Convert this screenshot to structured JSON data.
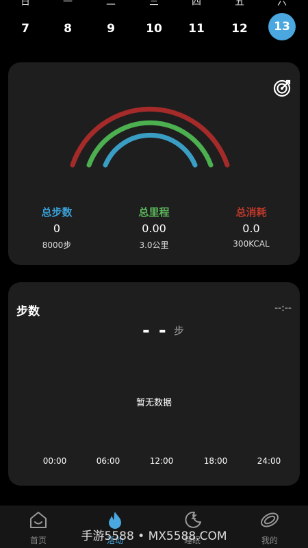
{
  "week": {
    "weekdays": [
      "日",
      "一",
      "二",
      "三",
      "四",
      "五",
      "六"
    ],
    "dates": [
      "7",
      "8",
      "9",
      "10",
      "11",
      "12",
      "13"
    ],
    "selected_index": 6
  },
  "summary": {
    "steps": {
      "label": "总步数",
      "value": "0",
      "goal": "8000步",
      "color": "#3aa0d8"
    },
    "distance": {
      "label": "总里程",
      "value": "0.00",
      "goal": "3.0公里",
      "color": "#5cb85c"
    },
    "calories": {
      "label": "总消耗",
      "value": "0.0",
      "goal": "300KCAL",
      "color": "#c0392b"
    }
  },
  "steps_card": {
    "title": "步数",
    "time": "--:--",
    "value": "- -",
    "unit": "步",
    "empty_text": "暂无数据",
    "ticks": [
      "00:00",
      "06:00",
      "12:00",
      "18:00",
      "24:00"
    ]
  },
  "nav": {
    "items": [
      {
        "label": "首页",
        "icon": "home-icon"
      },
      {
        "label": "活动",
        "icon": "flame-icon"
      },
      {
        "label": "睡眠",
        "icon": "moon-icon"
      },
      {
        "label": "我的",
        "icon": "ring-icon"
      }
    ],
    "active_index": 1,
    "accent": "#4aa7df"
  },
  "watermark": "手游5588 • MX5588.COM"
}
